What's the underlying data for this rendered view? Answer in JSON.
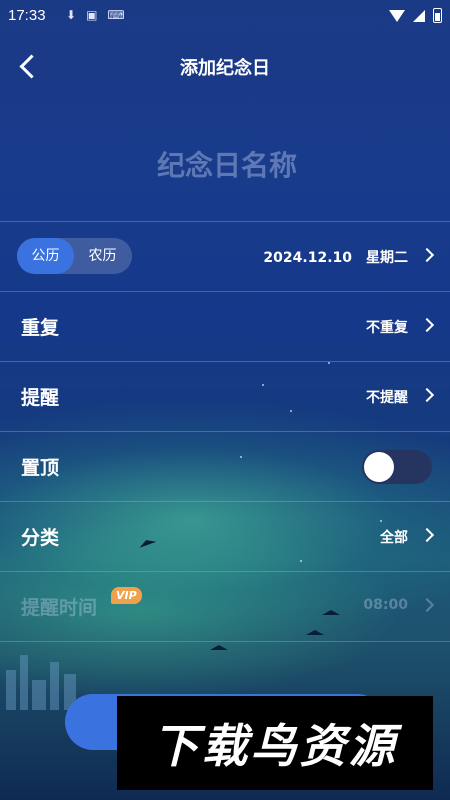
{
  "status_bar": {
    "time": "17:33"
  },
  "nav": {
    "title": "添加纪念日",
    "back_icon": "back-arrow-icon"
  },
  "name_input": {
    "placeholder": "纪念日名称",
    "value": ""
  },
  "date_row": {
    "calendar_tabs": [
      "公历",
      "农历"
    ],
    "selected_tab": "公历",
    "date": "2024.12.10",
    "weekday": "星期二"
  },
  "rows": {
    "repeat": {
      "label": "重复",
      "value": "不重复"
    },
    "remind": {
      "label": "提醒",
      "value": "不提醒"
    },
    "pin": {
      "label": "置顶",
      "enabled": false
    },
    "category": {
      "label": "分类",
      "value": "全部"
    },
    "remind_time": {
      "label": "提醒时间",
      "badge": "VIP",
      "value": "08:00"
    }
  },
  "watermark": {
    "text": "下载鸟资源"
  },
  "colors": {
    "accent": "#3a73e0",
    "vip_badge": "#f0a24a",
    "toggle_off": "#25355f"
  }
}
